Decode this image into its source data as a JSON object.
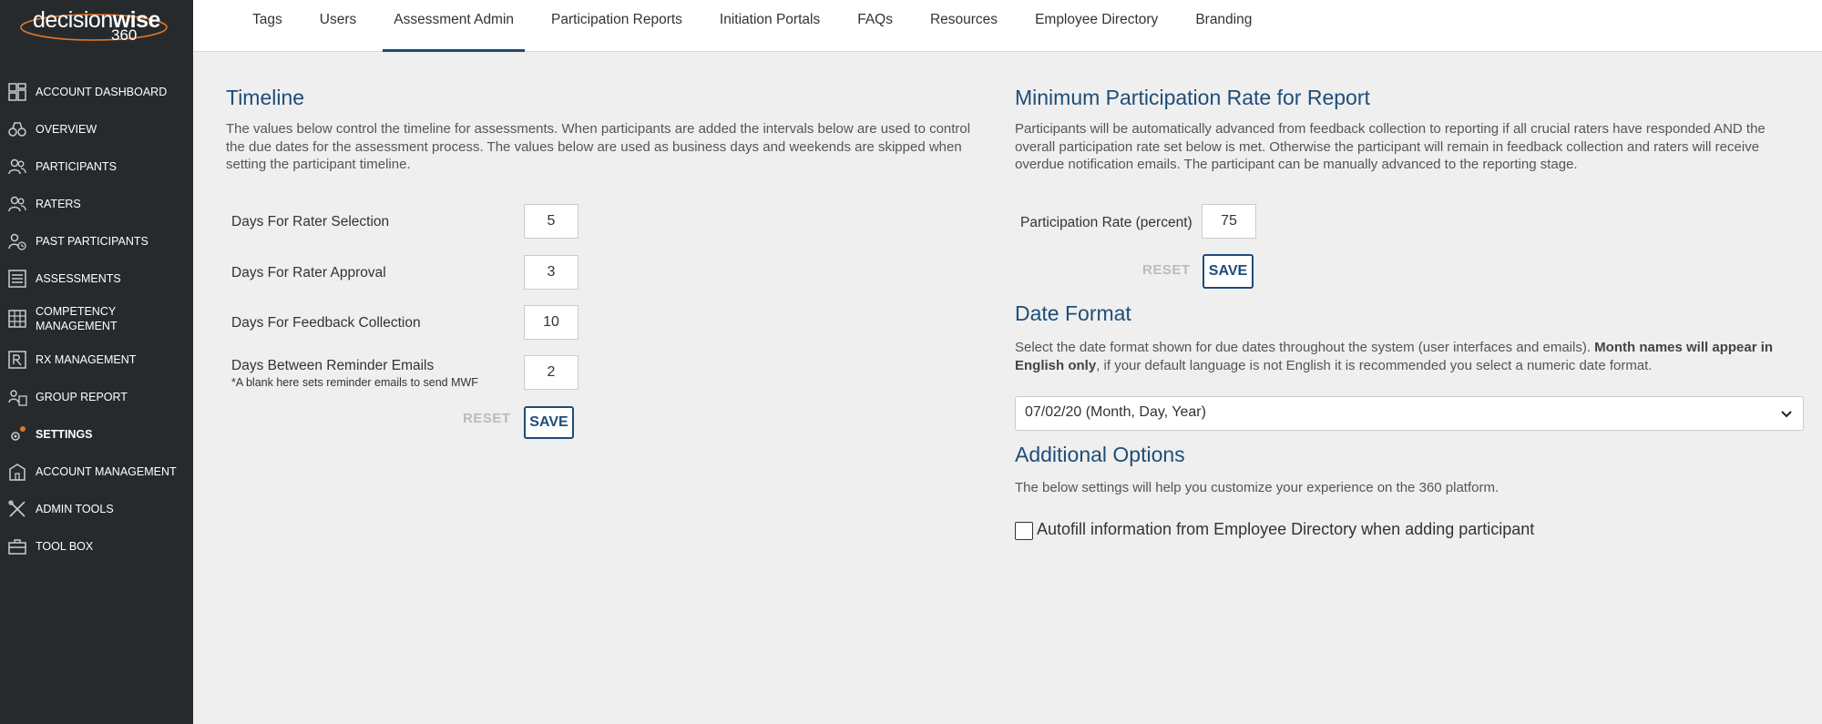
{
  "logo": {
    "brand_a": "decision",
    "brand_b": "wise",
    "brand_num": "360"
  },
  "sidebar": {
    "items": [
      {
        "label": "ACCOUNT DASHBOARD",
        "icon": "dashboard-icon"
      },
      {
        "label": "OVERVIEW",
        "icon": "binoculars-icon"
      },
      {
        "label": "PARTICIPANTS",
        "icon": "people-icon"
      },
      {
        "label": "RATERS",
        "icon": "people-icon"
      },
      {
        "label": "PAST PARTICIPANTS",
        "icon": "people-history-icon"
      },
      {
        "label": "ASSESSMENTS",
        "icon": "list-icon"
      },
      {
        "label": "COMPETENCY MANAGEMENT",
        "icon": "grid-icon"
      },
      {
        "label": "RX MANAGEMENT",
        "icon": "rx-icon"
      },
      {
        "label": "GROUP REPORT",
        "icon": "group-report-icon"
      },
      {
        "label": "SETTINGS",
        "icon": "gear-icon",
        "active": true
      },
      {
        "label": "ACCOUNT MANAGEMENT",
        "icon": "org-icon"
      },
      {
        "label": "ADMIN TOOLS",
        "icon": "tools-icon"
      },
      {
        "label": "TOOL BOX",
        "icon": "toolbox-icon"
      }
    ]
  },
  "tabs": [
    {
      "label": "Tags"
    },
    {
      "label": "Users"
    },
    {
      "label": "Assessment Admin",
      "active": true
    },
    {
      "label": "Participation Reports"
    },
    {
      "label": "Initiation Portals"
    },
    {
      "label": "FAQs"
    },
    {
      "label": "Resources"
    },
    {
      "label": "Employee Directory"
    },
    {
      "label": "Branding"
    }
  ],
  "timeline": {
    "title": "Timeline",
    "description": "The values below control the timeline for assessments. When participants are added the intervals below are used to control the due dates for the assessment process. The values below are used as business days and weekends are skipped when setting the participant timeline.",
    "rows": [
      {
        "label": "Days For Rater Selection",
        "value": "5"
      },
      {
        "label": "Days For Rater Approval",
        "value": "3"
      },
      {
        "label": "Days For Feedback Collection",
        "value": "10"
      },
      {
        "label": "Days Between Reminder Emails",
        "sub": "*A blank here sets reminder emails to send MWF",
        "value": "2"
      }
    ],
    "reset_label": "RESET",
    "save_label": "SAVE"
  },
  "participation": {
    "title": "Minimum Participation Rate for Report",
    "description": "Participants will be automatically advanced from feedback collection to reporting if all crucial raters have responded AND the overall participation rate set below is met. Otherwise the participant will remain in feedback collection and raters will receive overdue notification emails. The participant can be manually advanced to the reporting stage.",
    "label": "Participation Rate (percent)",
    "value": "75",
    "reset_label": "RESET",
    "save_label": "SAVE"
  },
  "date_format": {
    "title": "Date Format",
    "desc_a": "Select the date format shown for due dates throughout the system (user interfaces and emails). ",
    "desc_bold": "Month names will appear in English only",
    "desc_b": ", if your default language is not English it is recommended you select a numeric date format.",
    "selected": "07/02/20 (Month, Day, Year)"
  },
  "additional": {
    "title": "Additional Options",
    "description": "The below settings will help you customize your experience on the 360 platform.",
    "checkbox_label": "Autofill information from Employee Directory when adding participant",
    "checked": false
  },
  "colors": {
    "accent": "#1e4d78",
    "sidebar_bg": "#262a2d",
    "logo_swoosh": "#e0762a"
  }
}
